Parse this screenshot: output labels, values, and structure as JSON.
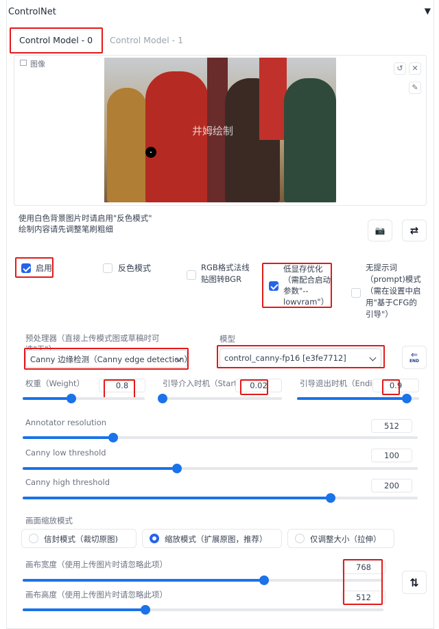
{
  "header": {
    "title": "ControlNet",
    "collapse_glyph": "▼"
  },
  "tabs": [
    {
      "label": "Control Model - 0",
      "active": true
    },
    {
      "label": "Control Model - 1",
      "active": false
    }
  ],
  "image_panel": {
    "label": "图像",
    "watermark": "井姆绘制"
  },
  "hint": {
    "line1": "使用白色背景图片时请启用\"反色模式\"",
    "line2": "绘制内容请先调整笔刷粗细"
  },
  "checkboxes": {
    "enable": {
      "label": "启用",
      "checked": true
    },
    "invert": {
      "label": "反色模式",
      "checked": false
    },
    "rgb_bgr": {
      "label": "RGB格式法线贴图转BGR",
      "checked": false
    },
    "lowvram": {
      "label": "低显存优化（需配合启动参数\"--lowvram\"）",
      "checked": true
    },
    "guess": {
      "label": "无提示词（prompt)模式（需在设置中启用\"基于CFG的引导\"）",
      "checked": false
    }
  },
  "preprocessor": {
    "label": "预处理器（直接上传模式图或草稿时可选\"无\"）",
    "value": "Canny 边缘检测（Canny edge detection）"
  },
  "model": {
    "label": "模型",
    "value": "control_canny-fp16 [e3fe7712]"
  },
  "sliders": {
    "weight": {
      "label": "权重（Weight）",
      "value": "0.8",
      "fraction": 0.4
    },
    "guidance_start": {
      "label": "引导介入时机（Starting Control Step）",
      "value": "0.02",
      "fraction": 0.02
    },
    "guidance_end": {
      "label": "引导退出时机（Ending Control Step）",
      "value": "0.9",
      "fraction": 0.9
    },
    "annotator_resolution": {
      "label": "Annotator resolution",
      "value": "512",
      "fraction": 0.23
    },
    "canny_low": {
      "label": "Canny low threshold",
      "value": "100",
      "fraction": 0.39
    },
    "canny_high": {
      "label": "Canny high threshold",
      "value": "200",
      "fraction": 0.78
    },
    "canvas_width": {
      "label": "画布宽度（使用上传图片时请忽略此项）",
      "value": "768",
      "fraction": 0.67
    },
    "canvas_height": {
      "label": "画布高度（使用上传图片时请忽略此项）",
      "value": "512",
      "fraction": 0.34
    }
  },
  "resize_mode": {
    "label": "画面缩放模式",
    "options": [
      "信封模式（裁切原图)",
      "缩放模式（扩展原图，推荐）",
      "仅调整大小（拉伸）"
    ],
    "selected": 1
  },
  "icons": {
    "camera": "📷",
    "swap": "⇄",
    "swap_vertical": "⇅",
    "end": "END"
  },
  "colors": {
    "accent": "#1a73e8",
    "highlight": "#e21818"
  }
}
